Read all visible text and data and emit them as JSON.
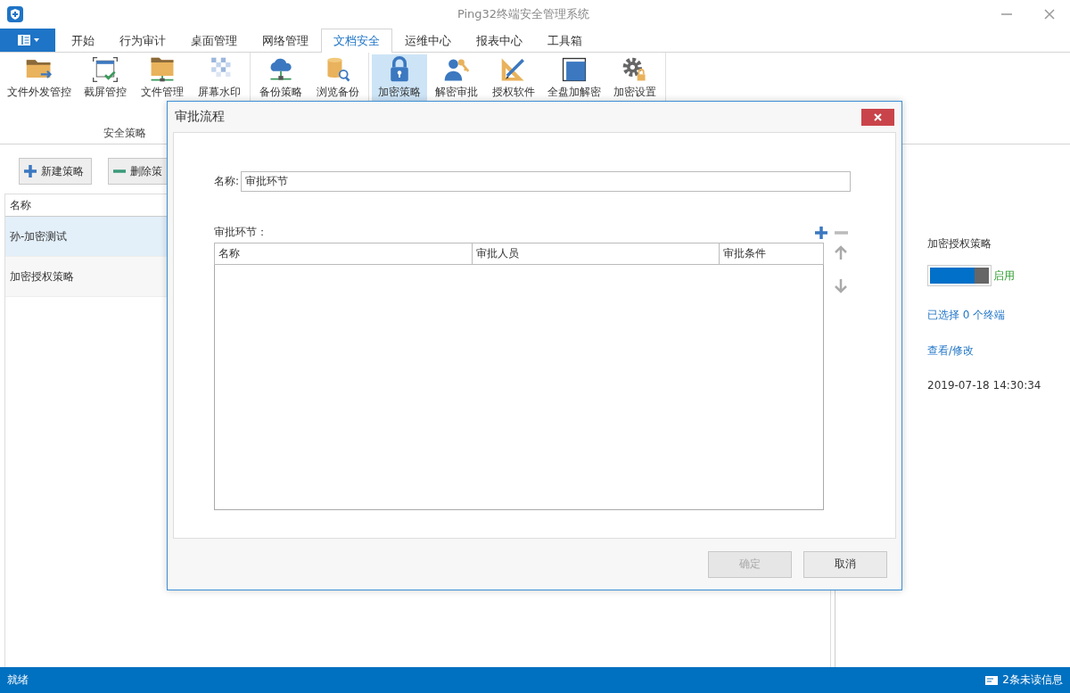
{
  "window": {
    "title": "Ping32终端安全管理系统"
  },
  "tabs": [
    {
      "label": "开始",
      "selected": false
    },
    {
      "label": "行为审计",
      "selected": false
    },
    {
      "label": "桌面管理",
      "selected": false
    },
    {
      "label": "网络管理",
      "selected": false
    },
    {
      "label": "文档安全",
      "selected": true
    },
    {
      "label": "运维中心",
      "selected": false
    },
    {
      "label": "报表中心",
      "selected": false
    },
    {
      "label": "工具箱",
      "selected": false
    }
  ],
  "ribbon": {
    "groups": [
      {
        "label": "安全策略",
        "items": [
          {
            "label": "文件外发管控",
            "kind": "folder-send",
            "selected": false
          },
          {
            "label": "截屏管控",
            "kind": "screenshot",
            "selected": false
          },
          {
            "label": "文件管理",
            "kind": "folder-network",
            "selected": false
          },
          {
            "label": "屏幕水印",
            "kind": "watermark",
            "selected": false
          }
        ]
      },
      {
        "items": [
          {
            "label": "备份策略",
            "kind": "cloud",
            "selected": false
          },
          {
            "label": "浏览备份",
            "kind": "database",
            "selected": false
          }
        ]
      },
      {
        "items": [
          {
            "label": "加密策略",
            "kind": "lock",
            "selected": true
          },
          {
            "label": "解密审批",
            "kind": "user-key",
            "selected": false
          },
          {
            "label": "授权软件",
            "kind": "ruler",
            "selected": false
          },
          {
            "label": "全盘加解密",
            "kind": "disk",
            "selected": false
          },
          {
            "label": "加密设置",
            "kind": "gear",
            "selected": false
          }
        ]
      }
    ]
  },
  "toolbar": [
    {
      "label": "新建策略",
      "kind": "add"
    },
    {
      "label": "删除策",
      "kind": "remove"
    }
  ],
  "policy_list": {
    "columns": [
      "名称"
    ],
    "rows": [
      {
        "name": "孙-加密测试",
        "selected": true
      },
      {
        "name": "加密授权策略",
        "selected": false
      }
    ]
  },
  "details": {
    "name": "加密授权策略",
    "status": {
      "on": true,
      "label": "启用"
    },
    "terminals_link": "已选择 0 个终端",
    "config_link": "查看/修改",
    "time": "2019-07-18 14:30:34"
  },
  "dialog": {
    "title": "审批流程",
    "name_label": "名称:",
    "name_value": "审批环节",
    "steps_label": "审批环节：",
    "columns": [
      "名称",
      "审批人员",
      "审批条件"
    ],
    "buttons": [
      {
        "label": "确定",
        "disabled": true
      },
      {
        "label": "取消",
        "disabled": false
      }
    ]
  },
  "status_bar": {
    "text": "就绪",
    "messages": "2条未读信息"
  }
}
